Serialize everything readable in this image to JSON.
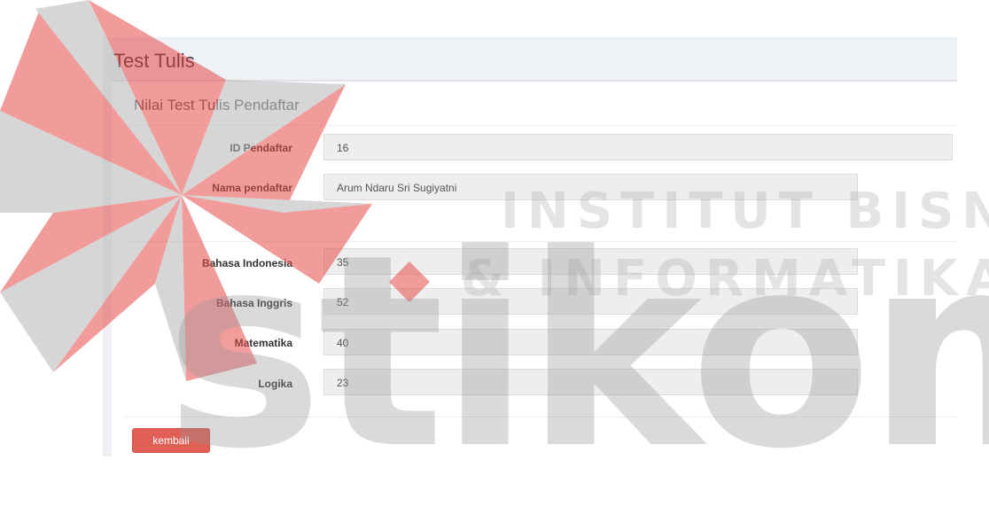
{
  "page": {
    "title": "Test Tulis",
    "subtitle": "Nilai Test Tulis Pendaftar"
  },
  "form": {
    "id_label": "ID Pendaftar",
    "id_value": "16",
    "name_label": "Nama pendaftar",
    "name_value": "Arum Ndaru Sri Sugiyatni",
    "scores": [
      {
        "label": "Bahasa Indonesia",
        "value": "35"
      },
      {
        "label": "Bahasa Inggris",
        "value": "52"
      },
      {
        "label": "Matematika",
        "value": "40"
      },
      {
        "label": "Logika",
        "value": "23"
      }
    ]
  },
  "actions": {
    "back_label": "kembali"
  },
  "watermark": {
    "line1": "INSTITUT BISNIS",
    "line2": "& INFORMATIKA",
    "logo_word": "stikom"
  },
  "colors": {
    "button": "#e05f57",
    "header_bg": "#eef1f5",
    "field_bg": "#eeeeee",
    "watermark_red": "#e84b4b"
  }
}
